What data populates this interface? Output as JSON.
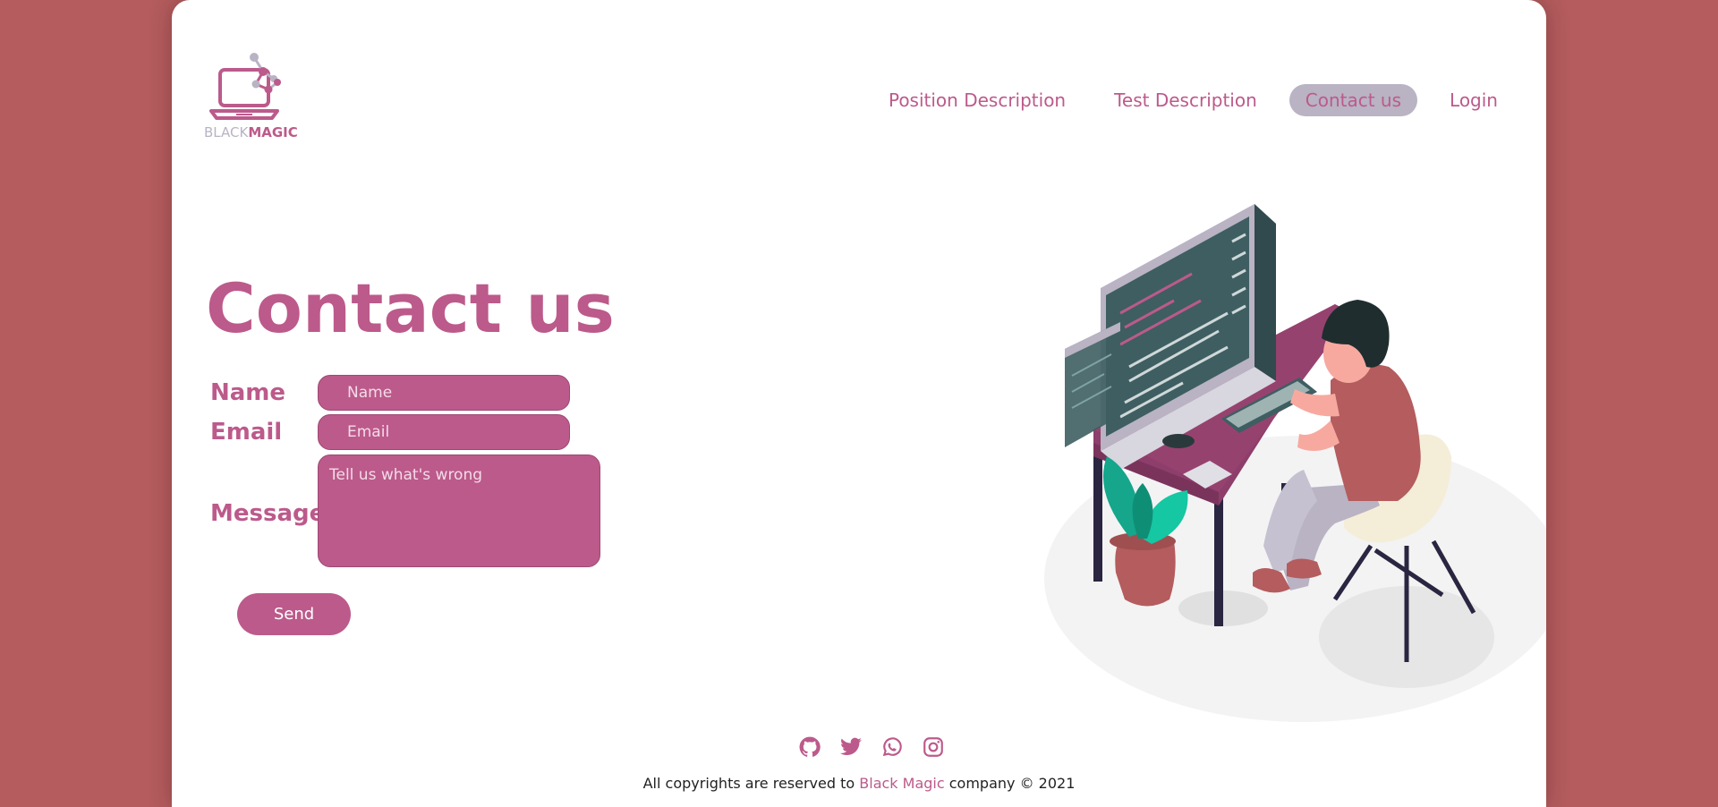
{
  "logo": {
    "text_light": "BLACK",
    "text_bold": "MAGIC"
  },
  "nav": [
    {
      "label": "Position Description",
      "active": false
    },
    {
      "label": "Test Description",
      "active": false
    },
    {
      "label": "Contact us",
      "active": true
    },
    {
      "label": "Login",
      "active": false
    }
  ],
  "page_title": "Contact us",
  "form": {
    "name_label": "Name",
    "name_placeholder": "Name",
    "email_label": "Email",
    "email_placeholder": "Email",
    "message_label": "Message",
    "message_placeholder": "Tell us what's wrong",
    "send_label": "Send"
  },
  "footer": {
    "socials": [
      "github-icon",
      "twitter-icon",
      "whatsapp-icon",
      "instagram-icon"
    ],
    "prefix": "All copyrights are reserved to",
    "brand": "Black Magic",
    "suffix": "company © 2021"
  },
  "colors": {
    "background": "#b45c5e",
    "accent": "#bc5a8b",
    "nav_active": "#b9b3c4"
  }
}
